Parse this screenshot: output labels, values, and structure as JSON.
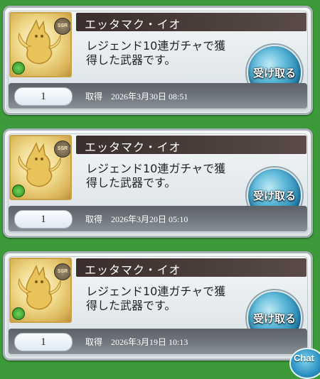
{
  "items": [
    {
      "name": "エッタマク・イオ",
      "description_line1": "レジェンド10連ガチャで獲",
      "description_line2": "得した武器です。",
      "quantity": "1",
      "acquired_label": "取得",
      "acquired_datetime": "2026年3月30日 08:51",
      "claim_label": "受け取る",
      "rarity_badge": "SSR",
      "element_icon": "wind-element-icon"
    },
    {
      "name": "エッタマク・イオ",
      "description_line1": "レジェンド10連ガチャで獲",
      "description_line2": "得した武器です。",
      "quantity": "1",
      "acquired_label": "取得",
      "acquired_datetime": "2026年3月20日 05:10",
      "claim_label": "受け取る",
      "rarity_badge": "SSR",
      "element_icon": "wind-element-icon"
    },
    {
      "name": "エッタマク・イオ",
      "description_line1": "レジェンド10連ガチャで獲",
      "description_line2": "得した武器です。",
      "quantity": "1",
      "acquired_label": "取得",
      "acquired_datetime": "2026年3月19日 10:13",
      "claim_label": "受け取る",
      "rarity_badge": "SSR",
      "element_icon": "wind-element-icon"
    }
  ],
  "chat_button": {
    "label": "Chat"
  },
  "colors": {
    "background": "#3c9a3a",
    "title_bar": "#3a2f2c",
    "claim_button": "#1c7aa8",
    "wind_element": "#2f8a22"
  }
}
